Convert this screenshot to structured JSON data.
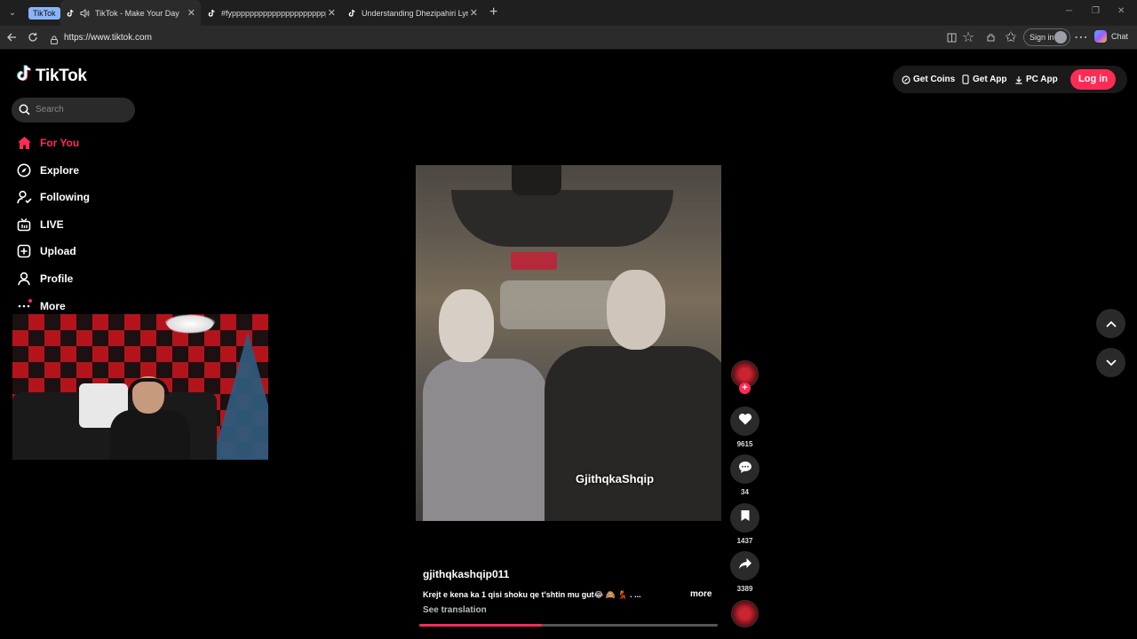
{
  "browser": {
    "tab_group_label": "TikTok",
    "tabs": [
      {
        "title": "TikTok - Make Your Day",
        "active": true
      },
      {
        "title": "#fypppppppppppppppppppppppp",
        "active": false
      },
      {
        "title": "Understanding Dhezipahiri Lyrics: ",
        "active": false
      }
    ],
    "url": "https://www.tiktok.com",
    "signin_label": "Sign in",
    "chat_label": "Chat"
  },
  "tiktok": {
    "logo_text": "TikTok",
    "search_placeholder": "Search",
    "nav": [
      {
        "label": "For You",
        "icon": "home-icon",
        "active": true
      },
      {
        "label": "Explore",
        "icon": "compass-icon",
        "active": false
      },
      {
        "label": "Following",
        "icon": "user-follow-icon",
        "active": false
      },
      {
        "label": "LIVE",
        "icon": "live-tv-icon",
        "active": false
      },
      {
        "label": "Upload",
        "icon": "plus-square-icon",
        "active": false
      },
      {
        "label": "Profile",
        "icon": "person-icon",
        "active": false
      },
      {
        "label": "More",
        "icon": "more-dots-icon",
        "active": false
      }
    ],
    "header": {
      "get_coins": "Get Coins",
      "get_app": "Get App",
      "pc_app": "PC App",
      "login": "Log in"
    },
    "video": {
      "watermark": "GjithqkaShqip",
      "username": "gjithqkashqip011",
      "description": "Krejt e kena ka 1 qisi shoku qe t'shtin mu gut😂 🙈 💃 . ...",
      "more_label": "more",
      "see_translation": "See translation",
      "progress": 0.41,
      "likes": "9615",
      "comments": "34",
      "saves": "1437",
      "shares": "3389"
    }
  },
  "colors": {
    "accent": "#fe2c55",
    "background": "#000000"
  }
}
